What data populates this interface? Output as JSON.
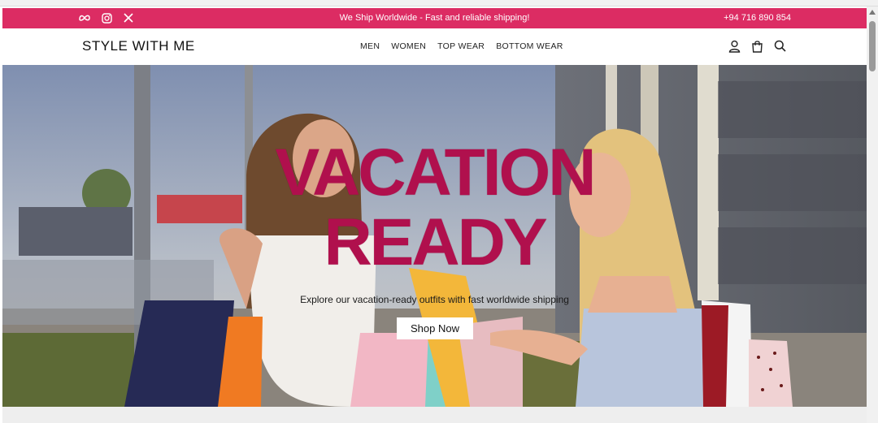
{
  "announcement": {
    "message": "We Ship Worldwide - Fast and reliable shipping!",
    "phone": "+94 716 890 854",
    "social": [
      "meta-icon",
      "instagram-icon",
      "x-icon"
    ],
    "bg_color": "#dc2c63"
  },
  "brand": {
    "name": "STYLE WITH ME"
  },
  "nav": {
    "items": [
      {
        "label": "MEN"
      },
      {
        "label": "WOMEN"
      },
      {
        "label": "TOP WEAR"
      },
      {
        "label": "BOTTOM WEAR"
      }
    ],
    "icons": [
      "user-icon",
      "shopping-bag-icon",
      "search-icon"
    ]
  },
  "hero": {
    "headline_line1": "VACATION",
    "headline_line2": "READY",
    "subtitle": "Explore our vacation-ready outfits with fast worldwide shipping",
    "cta_label": "Shop Now",
    "headline_color": "#b0104d"
  }
}
